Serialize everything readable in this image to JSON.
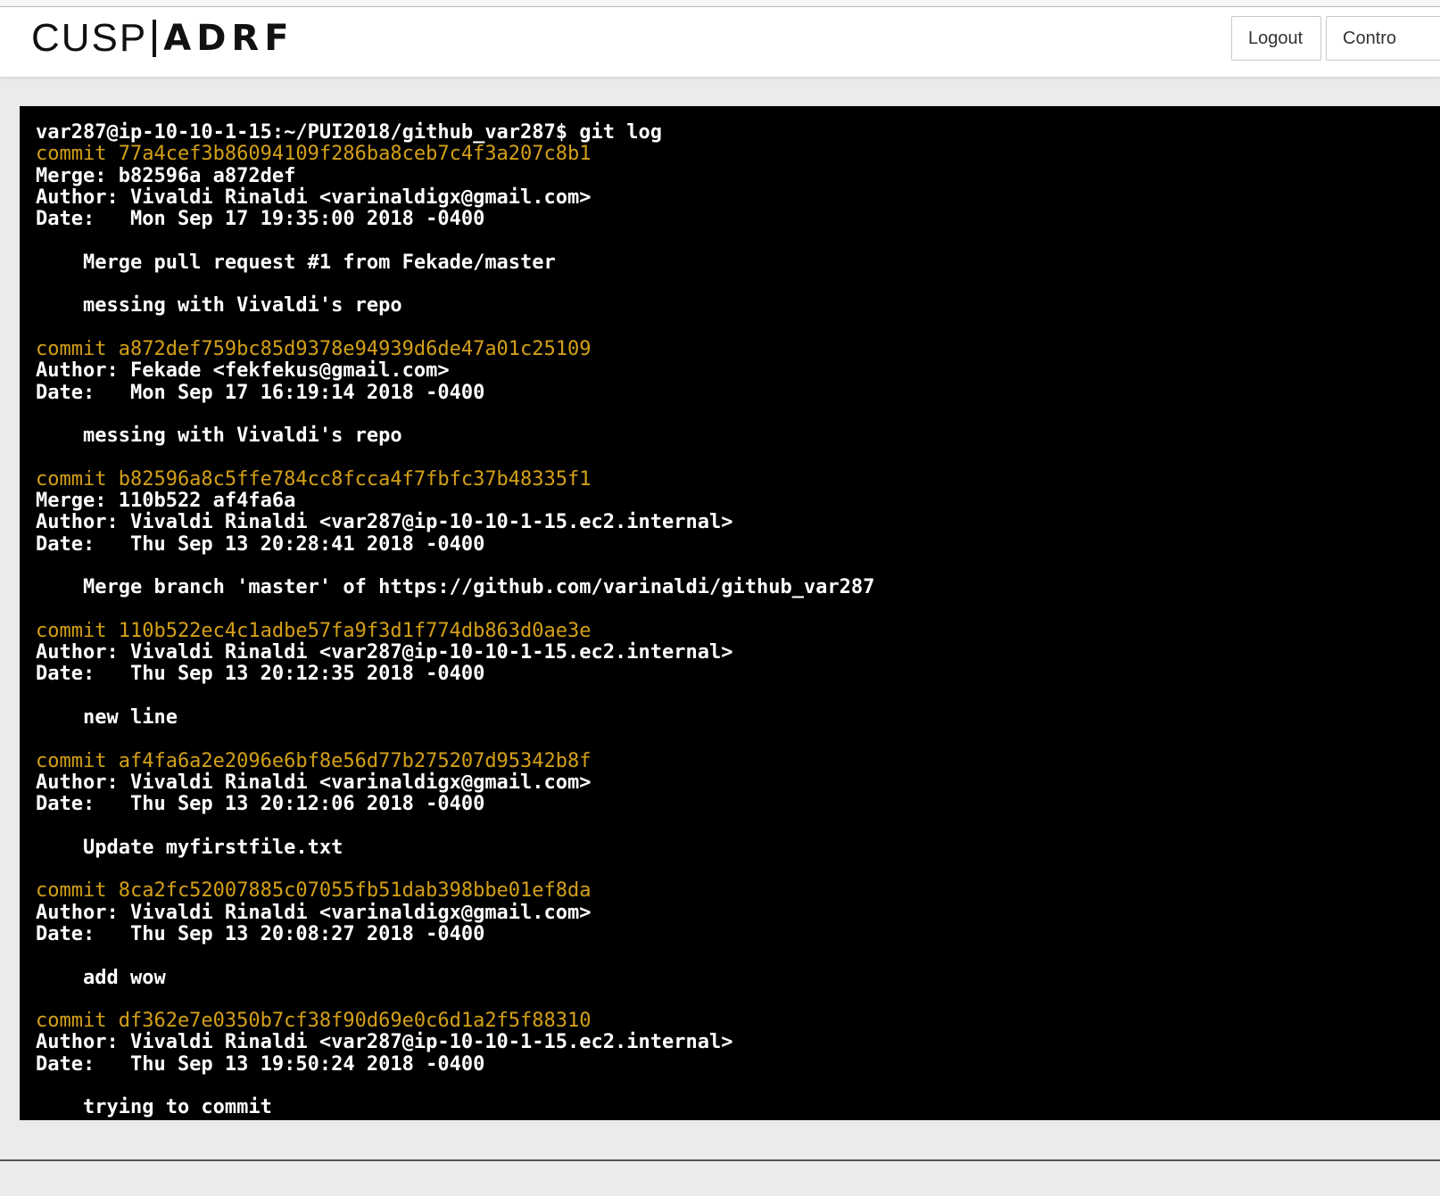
{
  "header": {
    "logo_left": "CUSP",
    "logo_right": "ADRF",
    "logout_label": "Logout",
    "control_label": "Contro"
  },
  "terminal": {
    "lines": [
      {
        "type": "text",
        "text": "var287@ip-10-10-1-15:~/PUI2018/github_var287$ git log"
      },
      {
        "type": "commit",
        "text": "commit 77a4cef3b86094109f286ba8ceb7c4f3a207c8b1"
      },
      {
        "type": "text",
        "text": "Merge: b82596a a872def"
      },
      {
        "type": "text",
        "text": "Author: Vivaldi Rinaldi <varinaldigx@gmail.com>"
      },
      {
        "type": "text",
        "text": "Date:   Mon Sep 17 19:35:00 2018 -0400"
      },
      {
        "type": "text",
        "text": ""
      },
      {
        "type": "text",
        "text": "    Merge pull request #1 from Fekade/master"
      },
      {
        "type": "text",
        "text": ""
      },
      {
        "type": "text",
        "text": "    messing with Vivaldi's repo"
      },
      {
        "type": "text",
        "text": ""
      },
      {
        "type": "commit",
        "text": "commit a872def759bc85d9378e94939d6de47a01c25109"
      },
      {
        "type": "text",
        "text": "Author: Fekade <fekfekus@gmail.com>"
      },
      {
        "type": "text",
        "text": "Date:   Mon Sep 17 16:19:14 2018 -0400"
      },
      {
        "type": "text",
        "text": ""
      },
      {
        "type": "text",
        "text": "    messing with Vivaldi's repo"
      },
      {
        "type": "text",
        "text": ""
      },
      {
        "type": "commit",
        "text": "commit b82596a8c5ffe784cc8fcca4f7fbfc37b48335f1"
      },
      {
        "type": "text",
        "text": "Merge: 110b522 af4fa6a"
      },
      {
        "type": "text",
        "text": "Author: Vivaldi Rinaldi <var287@ip-10-10-1-15.ec2.internal>"
      },
      {
        "type": "text",
        "text": "Date:   Thu Sep 13 20:28:41 2018 -0400"
      },
      {
        "type": "text",
        "text": ""
      },
      {
        "type": "text",
        "text": "    Merge branch 'master' of https://github.com/varinaldi/github_var287"
      },
      {
        "type": "text",
        "text": ""
      },
      {
        "type": "commit",
        "text": "commit 110b522ec4c1adbe57fa9f3d1f774db863d0ae3e"
      },
      {
        "type": "text",
        "text": "Author: Vivaldi Rinaldi <var287@ip-10-10-1-15.ec2.internal>"
      },
      {
        "type": "text",
        "text": "Date:   Thu Sep 13 20:12:35 2018 -0400"
      },
      {
        "type": "text",
        "text": ""
      },
      {
        "type": "text",
        "text": "    new line"
      },
      {
        "type": "text",
        "text": ""
      },
      {
        "type": "commit",
        "text": "commit af4fa6a2e2096e6bf8e56d77b275207d95342b8f"
      },
      {
        "type": "text",
        "text": "Author: Vivaldi Rinaldi <varinaldigx@gmail.com>"
      },
      {
        "type": "text",
        "text": "Date:   Thu Sep 13 20:12:06 2018 -0400"
      },
      {
        "type": "text",
        "text": ""
      },
      {
        "type": "text",
        "text": "    Update myfirstfile.txt"
      },
      {
        "type": "text",
        "text": ""
      },
      {
        "type": "commit",
        "text": "commit 8ca2fc52007885c07055fb51dab398bbe01ef8da"
      },
      {
        "type": "text",
        "text": "Author: Vivaldi Rinaldi <varinaldigx@gmail.com>"
      },
      {
        "type": "text",
        "text": "Date:   Thu Sep 13 20:08:27 2018 -0400"
      },
      {
        "type": "text",
        "text": ""
      },
      {
        "type": "text",
        "text": "    add wow"
      },
      {
        "type": "text",
        "text": ""
      },
      {
        "type": "commit",
        "text": "commit df362e7e0350b7cf38f90d69e0c6d1a2f5f88310"
      },
      {
        "type": "text",
        "text": "Author: Vivaldi Rinaldi <var287@ip-10-10-1-15.ec2.internal>"
      },
      {
        "type": "text",
        "text": "Date:   Thu Sep 13 19:50:24 2018 -0400"
      },
      {
        "type": "text",
        "text": ""
      },
      {
        "type": "text",
        "text": "    trying to commit"
      }
    ]
  },
  "colors": {
    "terminal_bg": "#000000",
    "terminal_text": "#ffffff",
    "commit_hash": "#d4a017",
    "page_bg": "#ebebeb"
  }
}
